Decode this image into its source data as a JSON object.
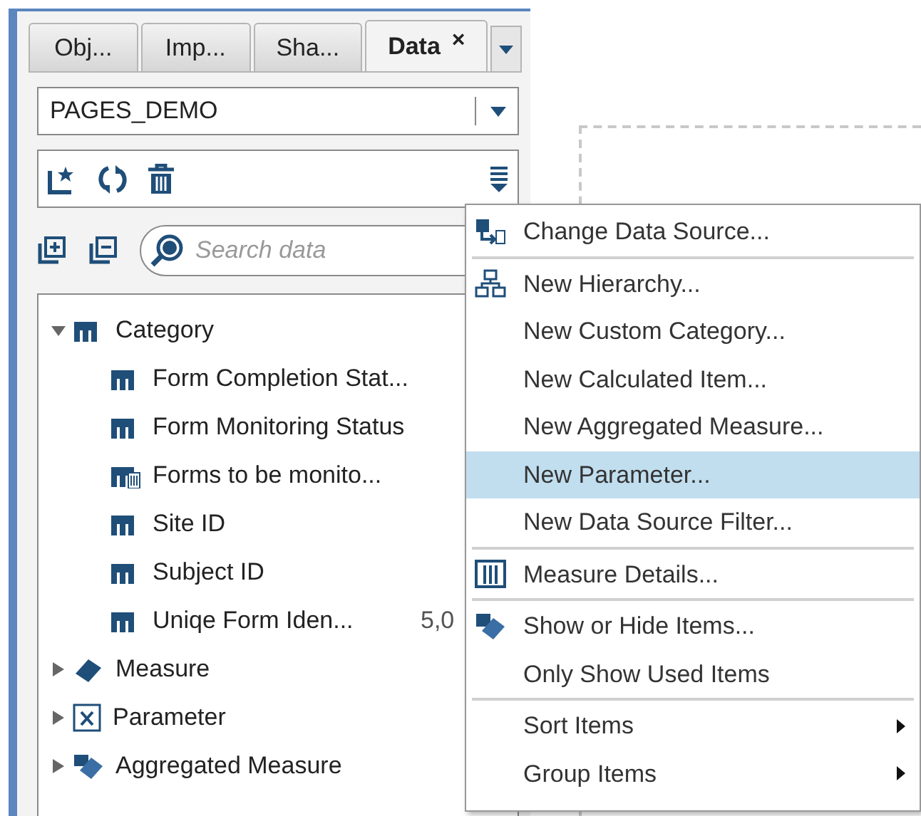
{
  "tabs": [
    {
      "label": "Obj...",
      "selected": false
    },
    {
      "label": "Imp...",
      "selected": false
    },
    {
      "label": "Sha...",
      "selected": false
    },
    {
      "label": "Data",
      "selected": true,
      "close": "×"
    }
  ],
  "data_source": {
    "value": "PAGES_DEMO"
  },
  "search": {
    "placeholder": "Search data"
  },
  "tree": [
    {
      "label": "Category",
      "kind": "category",
      "expanded": true,
      "children": [
        {
          "label": "Form Completion Stat...",
          "kind": "category"
        },
        {
          "label": "Form Monitoring Status",
          "kind": "category"
        },
        {
          "label": "Forms to be monito...",
          "kind": "calculated"
        },
        {
          "label": "Site ID",
          "kind": "category"
        },
        {
          "label": "Subject ID",
          "kind": "category"
        },
        {
          "label": "Uniqe Form Iden...",
          "kind": "category",
          "value": "5,0"
        }
      ]
    },
    {
      "label": "Measure",
      "kind": "measure",
      "expanded": false
    },
    {
      "label": "Parameter",
      "kind": "parameter",
      "expanded": false
    },
    {
      "label": "Aggregated Measure",
      "kind": "aggregated",
      "expanded": false
    }
  ],
  "menu": {
    "groups": [
      [
        {
          "label": "Change Data Source...",
          "kind": "source",
          "selected": false
        }
      ],
      [
        {
          "label": "New Hierarchy...",
          "kind": "hierarchy",
          "selected": false
        },
        {
          "label": "New Custom Category...",
          "kind": "plain",
          "selected": false
        },
        {
          "label": "New Calculated Item...",
          "kind": "plain",
          "selected": false
        },
        {
          "label": "New Aggregated Measure...",
          "kind": "plain",
          "selected": false
        },
        {
          "label": "New Parameter...",
          "kind": "plain",
          "selected": true
        },
        {
          "label": "New Data Source Filter...",
          "kind": "plain",
          "selected": false
        }
      ],
      [
        {
          "label": "Measure Details...",
          "kind": "details",
          "selected": false
        }
      ],
      [
        {
          "label": "Show or Hide Items...",
          "kind": "visibility",
          "selected": false
        },
        {
          "label": "Only Show Used Items",
          "kind": "plain",
          "selected": false
        }
      ],
      [
        {
          "label": "Sort Items",
          "kind": "submenu",
          "selected": false
        },
        {
          "label": "Group Items",
          "kind": "submenu",
          "selected": false
        }
      ]
    ]
  }
}
